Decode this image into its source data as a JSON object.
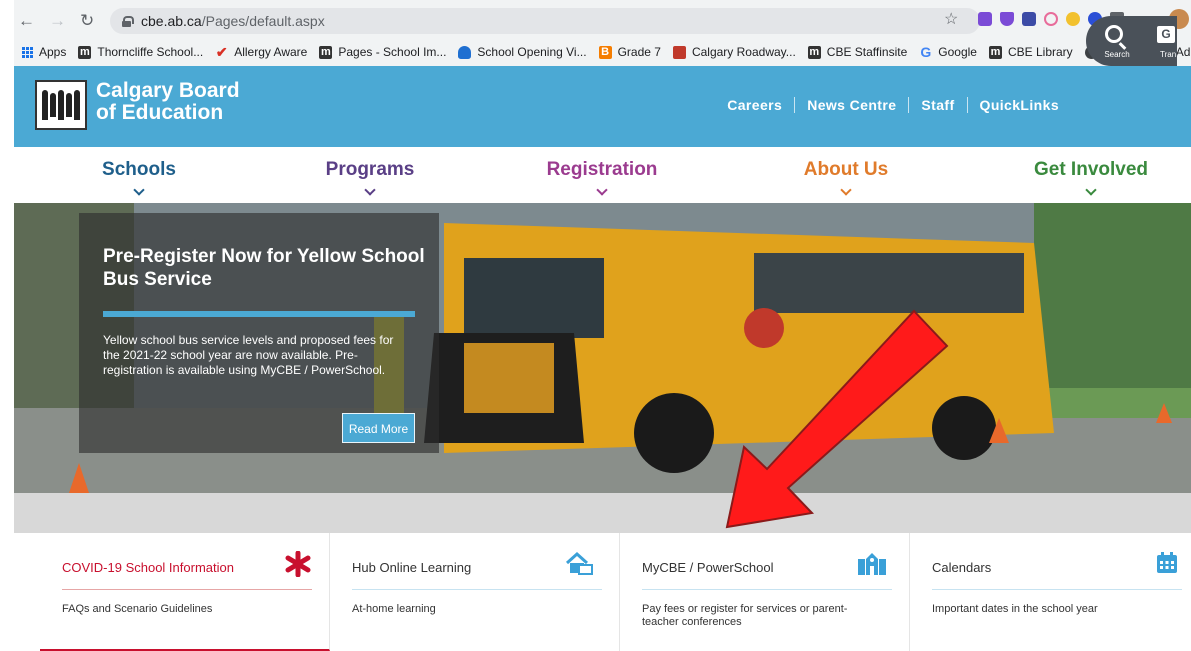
{
  "browser": {
    "url_host": "cbe.ab.ca",
    "url_path": "/Pages/default.aspx",
    "bookmarks": [
      {
        "label": "Apps",
        "icon": "apps-grid-icon"
      },
      {
        "label": "Thorncliffe School...",
        "icon": "cbe-logo-icon"
      },
      {
        "label": "Allergy Aware",
        "icon": "checkmark-icon"
      },
      {
        "label": "Pages - School Im...",
        "icon": "cbe-logo-icon"
      },
      {
        "label": "School Opening Vi...",
        "icon": "cloud-icon"
      },
      {
        "label": "Grade 7",
        "icon": "blogger-icon"
      },
      {
        "label": "Calgary Roadway...",
        "icon": "map-icon"
      },
      {
        "label": "CBE Staffinsite",
        "icon": "cbe-logo-icon"
      },
      {
        "label": "Google",
        "icon": "google-icon"
      },
      {
        "label": "CBE Library",
        "icon": "cbe-logo-icon"
      },
      {
        "label": "Evaluation of Adm...",
        "icon": "globe-icon"
      }
    ]
  },
  "header": {
    "logo_line1": "Calgary Board",
    "logo_line2": "of Education",
    "links": [
      "Careers",
      "News Centre",
      "Staff",
      "QuickLinks"
    ],
    "search_label": "Search",
    "translate_label": "Tran",
    "translate_icon_text": "G"
  },
  "nav": [
    {
      "label": "Schools",
      "color": "#1f5f8b"
    },
    {
      "label": "Programs",
      "color": "#5a3f86"
    },
    {
      "label": "Registration",
      "color": "#9b3b8f"
    },
    {
      "label": "About Us",
      "color": "#e07b2b"
    },
    {
      "label": "Get Involved",
      "color": "#3a8a3e"
    }
  ],
  "hero": {
    "title": "Pre-Register Now for Yellow School Bus Service",
    "body": "Yellow school bus service levels and proposed fees for the 2021-22 school year are now available. Pre-registration is available using MyCBE / PowerSchool.",
    "button": "Read More"
  },
  "cards": [
    {
      "title": "COVID-19 School Information",
      "desc": "FAQs and Scenario Guidelines",
      "icon": "asterisk-icon",
      "title_color": "#c8102e"
    },
    {
      "title": "Hub Online Learning",
      "desc": "At-home learning",
      "icon": "home-learning-icon",
      "title_color": "#333333"
    },
    {
      "title": "MyCBE / PowerSchool",
      "desc": "Pay fees or register for services or parent-teacher conferences",
      "icon": "school-building-icon",
      "title_color": "#333333"
    },
    {
      "title": "Calendars",
      "desc": "Important dates in the school year",
      "icon": "calendar-icon",
      "title_color": "#333333"
    }
  ],
  "colors": {
    "header_bg": "#4ba9d4",
    "accent_red": "#ff1a1a",
    "card_icon": "#3aa0d8"
  }
}
